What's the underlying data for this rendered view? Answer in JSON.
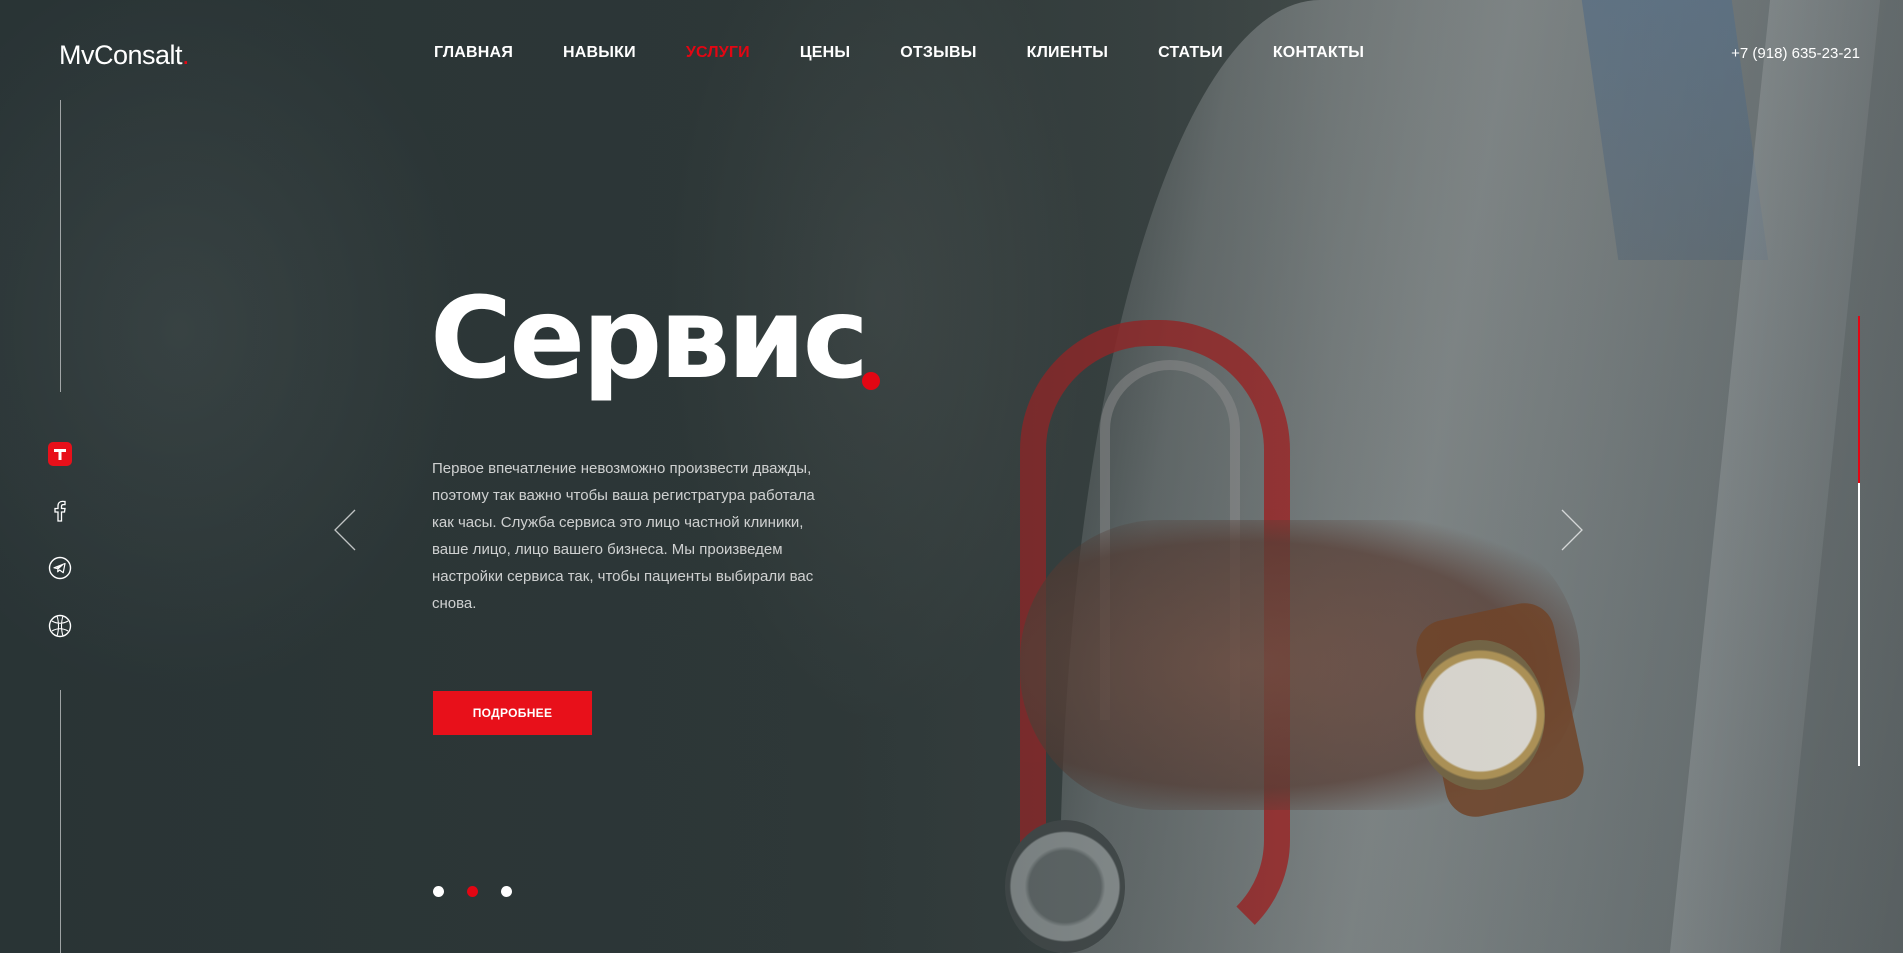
{
  "brand": {
    "name": "MvConsalt",
    "dot": ".",
    "accent": "#e30613"
  },
  "nav": {
    "items": [
      {
        "label": "ГЛАВНАЯ",
        "active": false
      },
      {
        "label": "НАВЫКИ",
        "active": false
      },
      {
        "label": "УСЛУГИ",
        "active": true
      },
      {
        "label": "ЦЕНЫ",
        "active": false
      },
      {
        "label": "ОТЗЫВЫ",
        "active": false
      },
      {
        "label": "КЛИЕНТЫ",
        "active": false
      },
      {
        "label": "СТАТЬИ",
        "active": false
      },
      {
        "label": "КОНТАКТЫ",
        "active": false
      }
    ]
  },
  "phone": "+7 (918) 635-23-21",
  "social": [
    {
      "icon": "tiktok-icon"
    },
    {
      "icon": "facebook-icon"
    },
    {
      "icon": "telegram-icon"
    },
    {
      "icon": "dribbble-icon"
    }
  ],
  "hero": {
    "title": "Сервис",
    "text": "Первое впечатление невозможно произвести дважды, поэтому так важно чтобы ваша регистратура работала как часы. Служба сервиса это лицо частной клиники, ваше лицо, лицо вашего бизнеса. Мы произведем настройки сервиса так, чтобы пациенты выбирали вас снова.",
    "button": "ПОДРОБНЕЕ"
  },
  "slider": {
    "slides": 3,
    "active": 2,
    "progress": 0.37
  }
}
